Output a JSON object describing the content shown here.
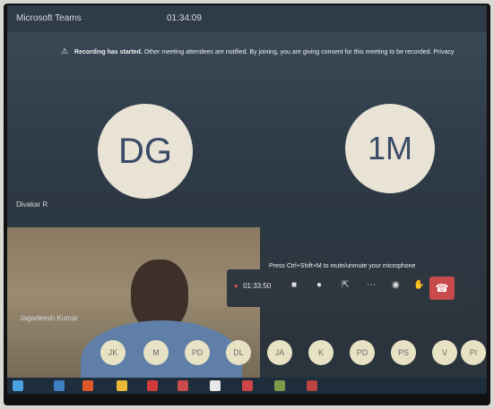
{
  "window": {
    "app_name": "Microsoft Teams",
    "meeting_time": "01:34:09"
  },
  "banner": {
    "bold_text": "Recording has started.",
    "text": "Other meeting attendees are notified. By joining, you are giving consent for this meeting to be recorded. Privacy"
  },
  "participants": {
    "tile1": {
      "initials": "DG",
      "name": "Divakar R"
    },
    "tile2": {
      "initials": "1M",
      "name": ""
    }
  },
  "video_tile": {
    "name": "Jagadeesh Kumar"
  },
  "controls": {
    "timer": "01:33:50",
    "raised_hand": ""
  },
  "notice": {
    "text": "Press Ctrl+Shift+M to mute/unmute your microphone"
  },
  "gallery": [
    "JK",
    "M",
    "PD",
    "DL",
    "JA",
    "K",
    "PD",
    "PS",
    "V",
    "PI"
  ],
  "colors": {
    "accent": "#c84a4a",
    "avatar_bg": "#e9e3d6",
    "text_initials": "#3a4a66"
  }
}
